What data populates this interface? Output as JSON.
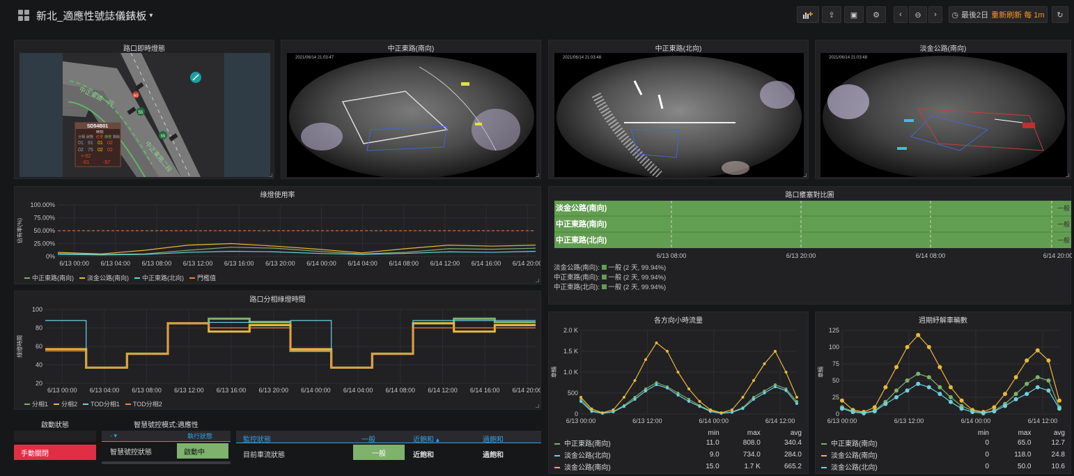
{
  "header": {
    "title": "新北_適應性號誌儀錶板",
    "time_range": "最後2日",
    "refresh": "重新刷新 每 1m"
  },
  "colors": {
    "green": "#7eb26d",
    "yellow": "#eab839",
    "cyan": "#6ed0e0",
    "orange": "#ef843c",
    "bg": "#161719",
    "panel": "#212124",
    "accent": "#f79520",
    "red": "#e02f44",
    "blue": "#33a2e5"
  },
  "icons": {
    "dashboard": "grid-icon",
    "add_panel": "bar-chart-plus-icon",
    "share": "share-icon",
    "save": "save-icon",
    "settings": "gear-icon",
    "back": "chevron-left-icon",
    "zoom": "zoom-out-icon",
    "forward": "chevron-right-icon",
    "clock": "clock-icon",
    "refresh": "refresh-icon"
  },
  "panels": {
    "map": {
      "title": "路口即時燈態",
      "road1": "中正東路一段",
      "road2": "中正東路二段",
      "device_id": "SD54B01",
      "labels": {
        "l1": "時刻:",
        "l2": "分相",
        "l3": "狀態",
        "l4": "紅燈",
        "l5": "綠燈",
        "l6": "剩餘"
      },
      "grid": [
        [
          "01",
          "91",
          "01",
          "02"
        ],
        [
          "02",
          "75",
          "02",
          "02"
        ]
      ],
      "foot1": "+-02",
      "foot2": "-01",
      "foot3": "-57",
      "speeds": [
        "60",
        "55",
        "55"
      ]
    },
    "cam1": {
      "title": "中正東路(南向)",
      "timestamp": "2021/06/14 21:03:47"
    },
    "cam2": {
      "title": "中正東路(北向)",
      "timestamp": "2021/06/14 21:03:48"
    },
    "cam3": {
      "title": "淡金公路(南向)",
      "timestamp": "2021/06/14 21:03:48"
    },
    "state": {
      "title": "路口壅塞對比圖",
      "rows": [
        "淡金公路(南向)",
        "中正東路(南向)",
        "中正東路(北向)"
      ],
      "end_labels": [
        "一般",
        "一般",
        "一般"
      ],
      "xticks": [
        "6/13 08:00",
        "6/13 20:00",
        "6/14 08:00",
        "6/14 20:00"
      ],
      "legend": [
        "淡金公路(南向):",
        "中正東路(南向):",
        "中正東路(北向):"
      ],
      "legend_value": "一般 (2 天, 99.94%)"
    },
    "usage": {
      "title": "綠燈使用率",
      "ylabel": "佔有率(%)"
    },
    "split": {
      "title": "路口分相綠燈時間",
      "ylabel": "綠燈時間"
    },
    "flow": {
      "title": "各方向小時流量",
      "ylabel": "車輛"
    },
    "cycle": {
      "title": "週期紓解車輛數",
      "ylabel": "車輛"
    },
    "status": {
      "title": "啟動狀態",
      "button": "手動關閉"
    },
    "mode": {
      "title": "智慧號控模式:適應性",
      "col1": "- ▾",
      "col2": "執行狀態",
      "row_label": "智慧號控狀態",
      "row_value": "啟動中"
    },
    "monitor": {
      "headers": [
        "監控狀態",
        "一般",
        "近飽和 ▴",
        "過飽和"
      ],
      "row": [
        "目前車流狀態",
        "一般",
        "近飽和",
        "過飽和"
      ]
    },
    "flow_table": {
      "headers": [
        "min",
        "max",
        "avg"
      ],
      "rows": [
        {
          "name": "中正東路(南向)",
          "min": "11.0",
          "max": "808.0",
          "avg": "340.4"
        },
        {
          "name": "淡金公路(北向)",
          "min": "9.0",
          "max": "734.0",
          "avg": "284.0"
        },
        {
          "name": "淡金公路(南向)",
          "min": "15.0",
          "max": "1.7 K",
          "avg": "665.2"
        }
      ]
    },
    "cycle_table": {
      "headers": [
        "min",
        "max",
        "avg"
      ],
      "rows": [
        {
          "name": "中正東路(南向)",
          "min": "0",
          "max": "65.0",
          "avg": "12.7"
        },
        {
          "name": "淡金公路(南向)",
          "min": "0",
          "max": "118.0",
          "avg": "24.8"
        },
        {
          "name": "淡金公路(北向)",
          "min": "0",
          "max": "50.0",
          "avg": "10.6"
        }
      ]
    }
  },
  "chart_data": [
    {
      "type": "line",
      "title": "綠燈使用率",
      "ylabel": "佔有率(%)",
      "xlabel": "",
      "ylim": [
        0,
        100
      ],
      "yticks": [
        "0%",
        "25.00%",
        "50.00%",
        "75.00%",
        "100.00%"
      ],
      "categories": [
        "6/13 00:00",
        "6/13 04:00",
        "6/13 08:00",
        "6/13 12:00",
        "6/13 16:00",
        "6/13 20:00",
        "6/14 00:00",
        "6/14 04:00",
        "6/14 08:00",
        "6/14 12:00",
        "6/14 16:00",
        "6/14 20:00"
      ],
      "series": [
        {
          "name": "中正東路(南向)",
          "color": "#7eb26d",
          "values": [
            6,
            4,
            5,
            12,
            18,
            16,
            10,
            5,
            8,
            15,
            14,
            16
          ]
        },
        {
          "name": "淡金公路(南向)",
          "color": "#eab839",
          "values": [
            8,
            5,
            12,
            22,
            25,
            20,
            14,
            7,
            15,
            22,
            20,
            22
          ]
        },
        {
          "name": "中正東路(北向)",
          "color": "#6ed0e0",
          "values": [
            4,
            3,
            4,
            8,
            10,
            9,
            6,
            4,
            6,
            9,
            8,
            10
          ]
        },
        {
          "name": "門檻值",
          "color": "#ef843c",
          "values": [
            50,
            50,
            50,
            50,
            50,
            50,
            50,
            50,
            50,
            50,
            50,
            50
          ]
        }
      ],
      "grid": true,
      "legend": "bottom-left"
    },
    {
      "type": "line",
      "title": "路口分相綠燈時間",
      "ylabel": "綠燈時間",
      "xlabel": "",
      "ylim": [
        20,
        100
      ],
      "yticks": [
        "20",
        "40",
        "60",
        "80",
        "100"
      ],
      "categories": [
        "6/13 00:00",
        "6/13 04:00",
        "6/13 08:00",
        "6/13 12:00",
        "6/13 16:00",
        "6/13 20:00",
        "6/14 00:00",
        "6/14 04:00",
        "6/14 08:00",
        "6/14 12:00",
        "6/14 16:00",
        "6/14 20:00"
      ],
      "series": [
        {
          "name": "分相1",
          "color": "#7eb26d",
          "values": [
            57,
            37,
            52,
            85,
            90,
            86,
            55,
            37,
            52,
            85,
            90,
            86
          ]
        },
        {
          "name": "分相2",
          "color": "#eab839",
          "values": [
            57,
            37,
            52,
            85,
            76,
            83,
            57,
            37,
            52,
            85,
            76,
            83
          ]
        },
        {
          "name": "TOD分相1",
          "color": "#6ed0e0",
          "values": [
            88,
            37,
            52,
            85,
            86,
            87,
            88,
            37,
            52,
            88,
            88,
            88
          ]
        },
        {
          "name": "TOD分相2",
          "color": "#ef843c",
          "values": [
            55,
            37,
            52,
            85,
            80,
            80,
            55,
            37,
            52,
            80,
            80,
            80
          ]
        }
      ],
      "grid": true,
      "legend": "bottom-left"
    },
    {
      "type": "line",
      "title": "各方向小時流量",
      "ylabel": "車輛",
      "xlabel": "",
      "ylim": [
        0,
        2000
      ],
      "yticks": [
        "0",
        "500",
        "1.0 K",
        "1.5 K",
        "2.0 K"
      ],
      "categories": [
        "6/13 00:00",
        "6/13 12:00",
        "6/14 00:00",
        "6/14 12:00"
      ],
      "series": [
        {
          "name": "中正東路(南向)",
          "color": "#7eb26d",
          "values": [
            350,
            80,
            20,
            60,
            200,
            400,
            600,
            750,
            650,
            500,
            350,
            200,
            80,
            20,
            50,
            150,
            400,
            550,
            700,
            600,
            300
          ]
        },
        {
          "name": "淡金公路(北向)",
          "color": "#6ed0e0",
          "values": [
            300,
            60,
            15,
            50,
            180,
            350,
            550,
            700,
            620,
            450,
            300,
            180,
            60,
            15,
            40,
            130,
            350,
            500,
            650,
            560,
            250
          ]
        },
        {
          "name": "淡金公路(南向)",
          "color": "#eab839",
          "values": [
            400,
            120,
            30,
            100,
            400,
            800,
            1300,
            1700,
            1500,
            1000,
            600,
            300,
            100,
            30,
            100,
            400,
            800,
            1200,
            1500,
            1000,
            400
          ]
        }
      ],
      "grid": true,
      "legend": "bottom-left"
    },
    {
      "type": "scatter",
      "title": "週期紓解車輛數",
      "ylabel": "車輛",
      "xlabel": "",
      "ylim": [
        0,
        125
      ],
      "yticks": [
        "0",
        "25",
        "50",
        "75",
        "100",
        "125"
      ],
      "categories": [
        "6/13 00:00",
        "6/13 12:00",
        "6/14 00:00",
        "6/14 12:00"
      ],
      "series": [
        {
          "name": "中正東路(南向)",
          "color": "#7eb26d",
          "values": [
            10,
            4,
            2,
            5,
            18,
            35,
            50,
            60,
            55,
            40,
            25,
            12,
            5,
            2,
            5,
            15,
            30,
            45,
            55,
            50,
            10
          ]
        },
        {
          "name": "淡金公路(南向)",
          "color": "#eab839",
          "values": [
            20,
            6,
            3,
            10,
            40,
            70,
            100,
            118,
            100,
            70,
            40,
            20,
            6,
            3,
            10,
            30,
            55,
            80,
            95,
            80,
            20
          ]
        },
        {
          "name": "淡金公路(北向)",
          "color": "#6ed0e0",
          "values": [
            8,
            3,
            1,
            4,
            15,
            25,
            35,
            45,
            40,
            30,
            18,
            8,
            3,
            1,
            4,
            12,
            22,
            30,
            40,
            35,
            8
          ]
        }
      ],
      "grid": true,
      "legend": "bottom-left"
    }
  ]
}
